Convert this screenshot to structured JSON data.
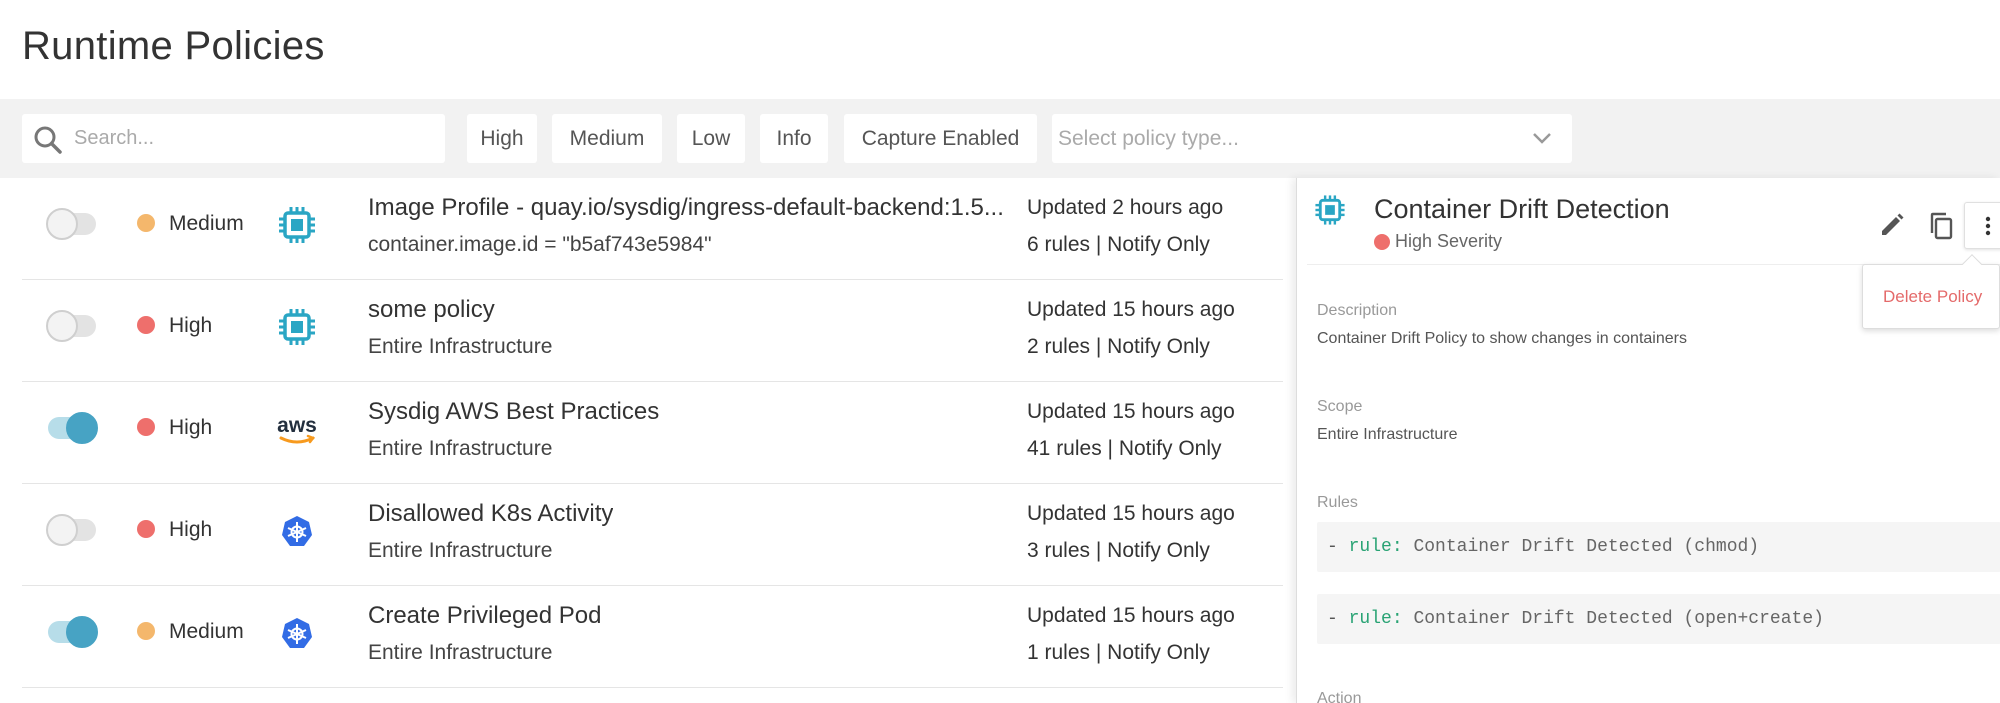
{
  "page": {
    "title": "Runtime Policies"
  },
  "filters": {
    "search_placeholder": "Search...",
    "chips": [
      "High",
      "Medium",
      "Low",
      "Info",
      "Capture Enabled"
    ],
    "type_placeholder": "Select policy type..."
  },
  "colors": {
    "high": "#ee6f6c",
    "medium": "#f4b76c",
    "accent": "#47a3c4",
    "k8s": "#326ce5",
    "delete": "#e46a6a",
    "rule_key": "#29a374"
  },
  "policies": [
    {
      "enabled": false,
      "severity": "Medium",
      "icon": "container-icon",
      "name": "Image Profile - quay.io/sysdig/ingress-default-backend:1.5...",
      "scope": "container.image.id = \"b5af743e5984\"",
      "updated": "Updated 2 hours ago",
      "rules": "6 rules | Notify Only"
    },
    {
      "enabled": false,
      "severity": "High",
      "icon": "container-icon",
      "name": "some policy",
      "scope": "Entire Infrastructure",
      "updated": "Updated 15 hours ago",
      "rules": "2 rules | Notify Only"
    },
    {
      "enabled": true,
      "severity": "High",
      "icon": "aws-icon",
      "name": "Sysdig AWS Best Practices",
      "scope": "Entire Infrastructure",
      "updated": "Updated 15 hours ago",
      "rules": "41 rules | Notify Only"
    },
    {
      "enabled": false,
      "severity": "High",
      "icon": "kubernetes-icon",
      "name": "Disallowed K8s Activity",
      "scope": "Entire Infrastructure",
      "updated": "Updated 15 hours ago",
      "rules": "3 rules | Notify Only"
    },
    {
      "enabled": true,
      "severity": "Medium",
      "icon": "kubernetes-icon",
      "name": "Create Privileged Pod",
      "scope": "Entire Infrastructure",
      "updated": "Updated 15 hours ago",
      "rules": "1 rules | Notify Only"
    }
  ],
  "detail": {
    "title": "Container Drift Detection",
    "severity": "High Severity",
    "menu": {
      "delete_label": "Delete Policy"
    },
    "description_label": "Description",
    "description": "Container Drift Policy to show changes in containers",
    "scope_label": "Scope",
    "scope": "Entire Infrastructure",
    "rules_label": "Rules",
    "rules": [
      {
        "dash": "-",
        "key": "rule:",
        "value": "Container Drift Detected (chmod)"
      },
      {
        "dash": "-",
        "key": "rule:",
        "value": "Container Drift Detected (open+create)"
      }
    ],
    "action_label": "Action"
  }
}
